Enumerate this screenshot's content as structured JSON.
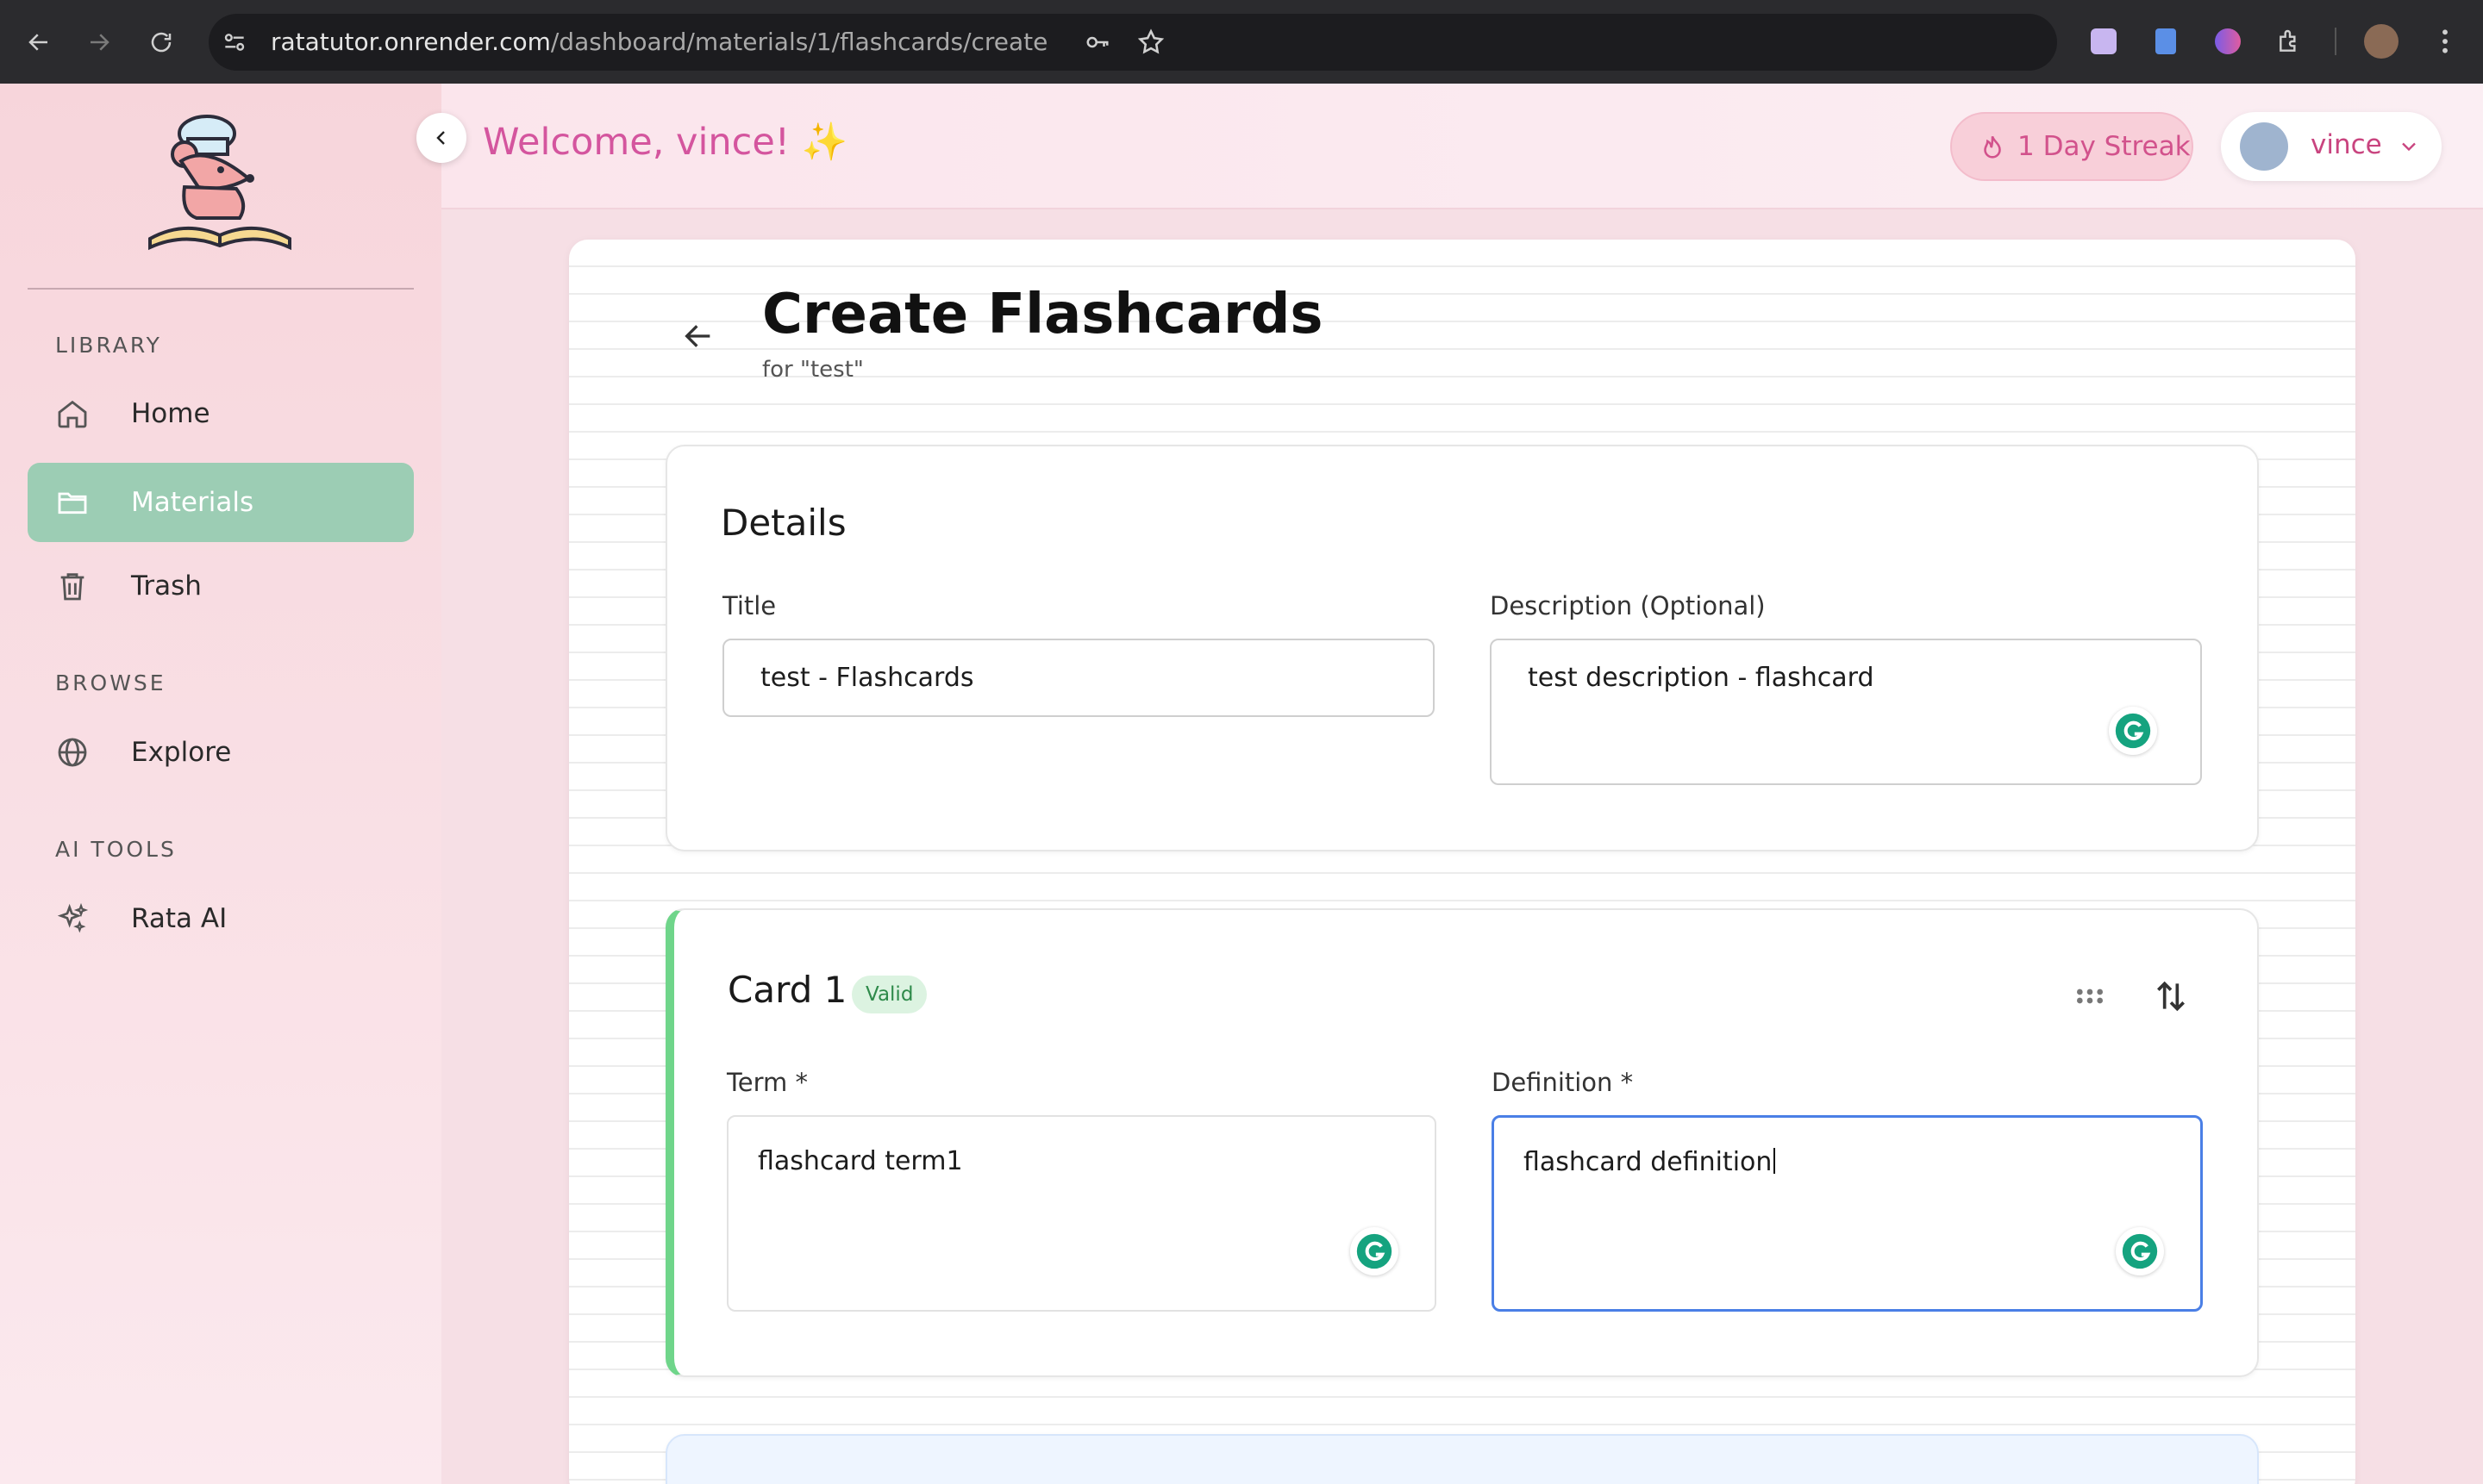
{
  "browser": {
    "url_host": "ratatutor.onrender.com",
    "url_path": "/dashboard/materials/1/flashcards/create",
    "icons": [
      "back-icon",
      "forward-icon",
      "reload-icon",
      "site-settings-icon",
      "password-key-icon",
      "bookmark-star-icon",
      "extension-icon",
      "extension-icon",
      "extension-icon",
      "extensions-puzzle-icon",
      "profile-avatar",
      "kebab-menu-icon"
    ]
  },
  "sidebar": {
    "sections": [
      {
        "title": "LIBRARY"
      },
      {
        "title": "BROWSE"
      },
      {
        "title": "AI TOOLS"
      }
    ],
    "items": [
      {
        "label": "Home",
        "icon": "home-icon",
        "active": false
      },
      {
        "label": "Materials",
        "icon": "folder-icon",
        "active": true
      },
      {
        "label": "Trash",
        "icon": "trash-icon",
        "active": false
      },
      {
        "label": "Explore",
        "icon": "globe-icon",
        "active": false
      },
      {
        "label": "Rata AI",
        "icon": "sparkles-icon",
        "active": false
      }
    ]
  },
  "header": {
    "welcome": "Welcome, vince! ✨",
    "streak_label": "1 Day Streak",
    "user_name": "vince"
  },
  "page": {
    "title": "Create Flashcards",
    "subtitle": "for \"test\""
  },
  "details": {
    "heading": "Details",
    "title_label": "Title",
    "title_value": "test - Flashcards",
    "description_label": "Description (Optional)",
    "description_value": "test description - flashcard"
  },
  "card1": {
    "title": "Card 1",
    "badge": "Valid",
    "term_label": "Term *",
    "term_value": "flashcard term1",
    "definition_label": "Definition *",
    "definition_value": "flashcard definition"
  },
  "colors": {
    "accent_pink": "#d4559e",
    "active_green": "#9ccdb4",
    "valid_green": "#6fd58a",
    "focus_blue": "#4a7fe6"
  }
}
